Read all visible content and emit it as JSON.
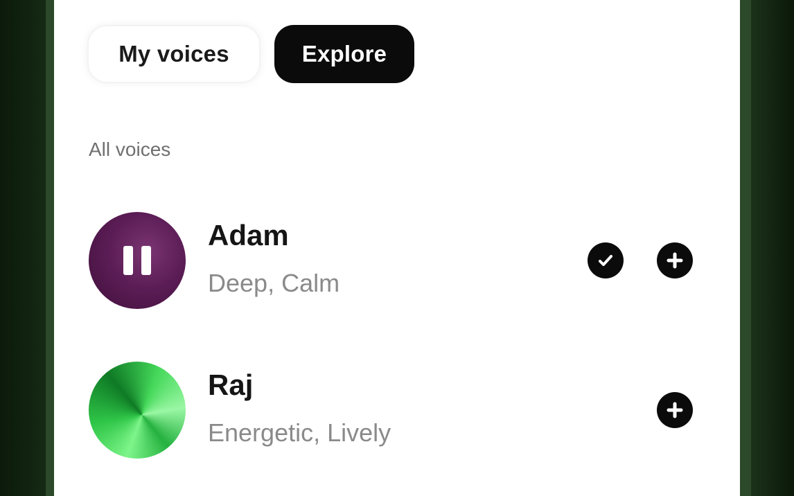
{
  "tabs": [
    {
      "label": "My voices",
      "active": false
    },
    {
      "label": "Explore",
      "active": true
    }
  ],
  "section": {
    "label": "All voices"
  },
  "voices": [
    {
      "name": "Adam",
      "description": "Deep, Calm",
      "playing": true,
      "selected": true,
      "avatar_icon": "pause-icon",
      "actions": [
        "check-icon",
        "add-icon"
      ]
    },
    {
      "name": "Raj",
      "description": "Energetic, Lively",
      "playing": false,
      "selected": false,
      "avatar_icon": "none",
      "actions": [
        "add-icon"
      ]
    }
  ],
  "colors": {
    "active_tab_bg": "#0b0b0b",
    "adam_avatar": "#5c1d56",
    "raj_avatar": "#2fc648",
    "background": "#152a14"
  }
}
